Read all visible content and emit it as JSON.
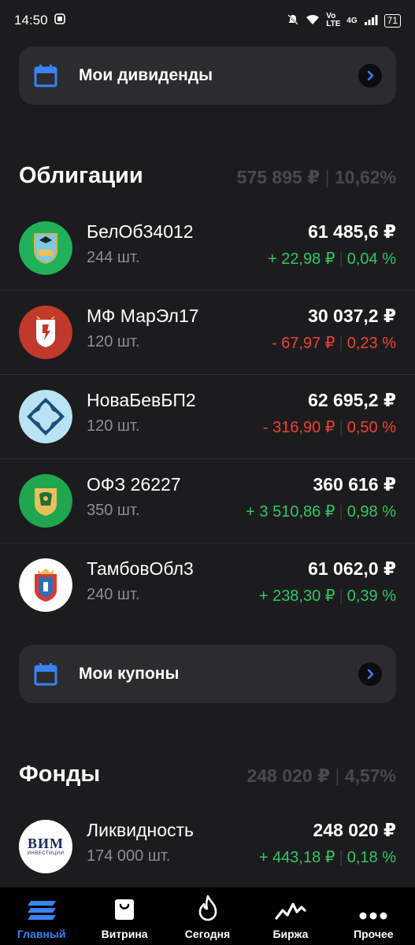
{
  "status": {
    "time": "14:50",
    "network": "4G",
    "volte": "Vo LTE",
    "battery": "71"
  },
  "dividends": {
    "label": "Мои дивиденды"
  },
  "bonds": {
    "title": "Облигации",
    "total": "575 895 ₽",
    "share": "10,62%",
    "items": [
      {
        "name": "БелОб34012",
        "qty": "244 шт.",
        "price": "61 485,6 ₽",
        "change": "+ 22,98 ₽",
        "pct": "0,04 %",
        "trend": "pos"
      },
      {
        "name": "МФ МарЭл17",
        "qty": "120 шт.",
        "price": "30 037,2 ₽",
        "change": "- 67,97 ₽",
        "pct": "0,23 %",
        "trend": "neg"
      },
      {
        "name": "НоваБевБП2",
        "qty": "120 шт.",
        "price": "62 695,2 ₽",
        "change": "- 316,90 ₽",
        "pct": "0,50 %",
        "trend": "neg"
      },
      {
        "name": "ОФЗ 26227",
        "qty": "350 шт.",
        "price": "360 616 ₽",
        "change": "+ 3 510,86 ₽",
        "pct": "0,98 %",
        "trend": "pos"
      },
      {
        "name": "ТамбовОбл3",
        "qty": "240 шт.",
        "price": "61 062,0 ₽",
        "change": "+ 238,30 ₽",
        "pct": "0,39 %",
        "trend": "pos"
      }
    ]
  },
  "coupons": {
    "label": "Мои купоны"
  },
  "funds": {
    "title": "Фонды",
    "total": "248 020 ₽",
    "share": "4,57%",
    "items": [
      {
        "name": "Ликвидность",
        "qty": "174 000 шт.",
        "price": "248 020 ₽",
        "change": "+ 443,18 ₽",
        "pct": "0,18 %",
        "trend": "pos",
        "logo_text": "ВИМ",
        "logo_sub": "ИНВЕСТИЦИИ"
      }
    ]
  },
  "nav": [
    {
      "label": "Главный",
      "icon": "home-stack-icon",
      "active": true
    },
    {
      "label": "Витрина",
      "icon": "shopping-bag-icon",
      "active": false
    },
    {
      "label": "Сегодня",
      "icon": "flame-icon",
      "active": false
    },
    {
      "label": "Биржа",
      "icon": "pulse-icon",
      "active": false
    },
    {
      "label": "Прочее",
      "icon": "more-dots-icon",
      "active": false
    }
  ],
  "colors": {
    "accent": "#3b82f6",
    "positive": "#30c766",
    "negative": "#ef4135",
    "background": "#1c1c1e",
    "card": "#2c2c2e"
  }
}
